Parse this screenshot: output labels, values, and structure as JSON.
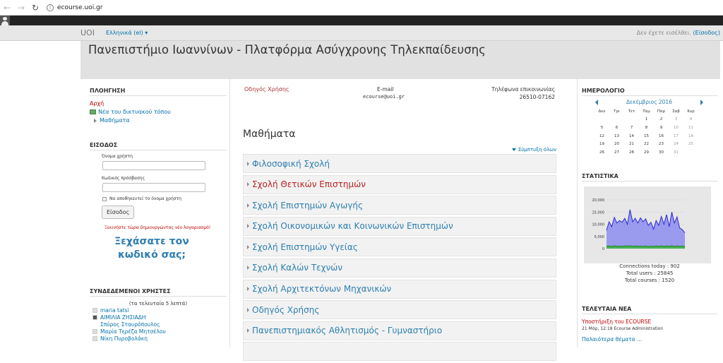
{
  "browser": {
    "url": "ecourse.uoi.gr"
  },
  "topnav": {
    "brand": "UOI",
    "language": "Ελληνικά (el) ▾",
    "login_status": "Δεν έχετε εισέλθει.",
    "login_link": "(Είσοδος)"
  },
  "header": {
    "title": "Πανεπιστήμιο Ιωαννίνων - Πλατφόρμα Ασύγχρονης Τηλεκπαίδευσης"
  },
  "navigation": {
    "title": "ΠΛΟΗΓΗΣΗ",
    "home": "Αρχή",
    "site_news": "Νέα του δικτυακού τόπου",
    "courses": "Μαθήματα"
  },
  "login": {
    "title": "ΕΙΣΟΔΟΣ",
    "username_label": "Όνομα χρήστη",
    "password_label": "Κωδικός πρόσβασης",
    "remember_label": "Να αποθηκευτεί το όνομα χρήστη",
    "submit": "Είσοδος",
    "signup": "Ξεκινήστε τώρα δημιουργώντας νέο λογαριασμό!",
    "forgot": "Ξεχάσατε τον κωδικό σας;"
  },
  "online": {
    "title": "ΣΥΝΔΕΔΕΜΕΝΟΙ ΧΡΗΣΤΕΣ",
    "subtitle": "(τα τελευταία 5 λεπτά)",
    "users": [
      "maria tatsi",
      "ΑΙΜΙΛΙΑ ΖΗΣΙΑΔΗ",
      "Σπύρος Σταυρόπουλος",
      "Μαρία Τερέζα Μητσέλου",
      "Νίκη Πυροβολάκη"
    ]
  },
  "contact": {
    "guide": "Οδηγός Χρήσης",
    "email_label": "E-mail",
    "email_value": "ecourse@uoi.gr",
    "phone_label": "Τηλέφωνα επικοινωνίας",
    "phone_value": "26510-07162"
  },
  "courses": {
    "title": "Μαθήματα",
    "collapse_all": "Σύμπτυξη όλων",
    "categories": [
      "Φιλοσοφική Σχολή",
      "Σχολή Θετικών Επιστημών",
      "Σχολή Επιστημών Αγωγής",
      "Σχολή Οικονομικών και Κοινωνικών Επιστημών",
      "Σχολή Επιστημών Υγείας",
      "Σχολή Καλών Τεχνών",
      "Σχολή Αρχιτεκτόνων Μηχανικών",
      "Οδηγός Χρήσης",
      "Πανεπιστημιακός Αθλητισμός - Γυμναστήριο"
    ]
  },
  "calendar": {
    "title": "ΗΜΕΡΟΛΟΓΙΟ",
    "month": "Δεκέμβριος 2016",
    "weekdays": [
      "Δευ",
      "Τρι",
      "Τετ",
      "Πεμ",
      "Παρ",
      "Σαβ",
      "Κυρ"
    ],
    "weeks": [
      [
        "",
        "",
        "",
        "1",
        "2",
        "3",
        "4"
      ],
      [
        "5",
        "6",
        "7",
        "8",
        "9",
        "10",
        "11"
      ],
      [
        "12",
        "13",
        "14",
        "15",
        "16",
        "17",
        "18"
      ],
      [
        "19",
        "20",
        "21",
        "22",
        "23",
        "24",
        "25"
      ],
      [
        "26",
        "27",
        "28",
        "29",
        "30",
        "31",
        ""
      ]
    ]
  },
  "stats": {
    "title": "ΣΤΑΤΙΣΤΙΚΑ",
    "connections_today": "Connections today : 902",
    "total_users": "Total users : 25845",
    "total_courses": "Total courses : 1520"
  },
  "news": {
    "title": "ΤΕΛΕΥΤΑΙΑ ΝΕΑ",
    "item_title": "Υποστήριξη του ECOURSE",
    "item_meta": "21 Μάρ, 12:18 Ecourse Administration",
    "older": "Παλαιότερα θέματα ..."
  },
  "chart_data": {
    "type": "area",
    "yticks": [
      "20,000",
      "15,000",
      "10,000",
      "5,000",
      "0"
    ],
    "ylim": [
      0,
      20000
    ],
    "series": [
      {
        "color": "#8c8cf0",
        "values": [
          7500,
          11000,
          9000,
          12800,
          10500,
          11500,
          10800,
          12400,
          10000,
          16000,
          11000,
          12500,
          10500,
          12600,
          11000,
          12200,
          9500,
          10800,
          8000,
          11500,
          9500,
          13200,
          10000,
          14000,
          9000,
          15000,
          10500,
          13000,
          8500,
          7800,
          6500
        ]
      },
      {
        "color": "#3cb43c",
        "values": [
          900,
          1100,
          800,
          1200,
          900,
          1050,
          850,
          1150,
          1000,
          1200,
          900,
          1100,
          950,
          1050,
          900,
          1100,
          850,
          1000,
          900,
          1050,
          950,
          1150,
          900,
          1100,
          950,
          1200,
          900,
          1100,
          950,
          1000,
          850
        ]
      }
    ]
  }
}
